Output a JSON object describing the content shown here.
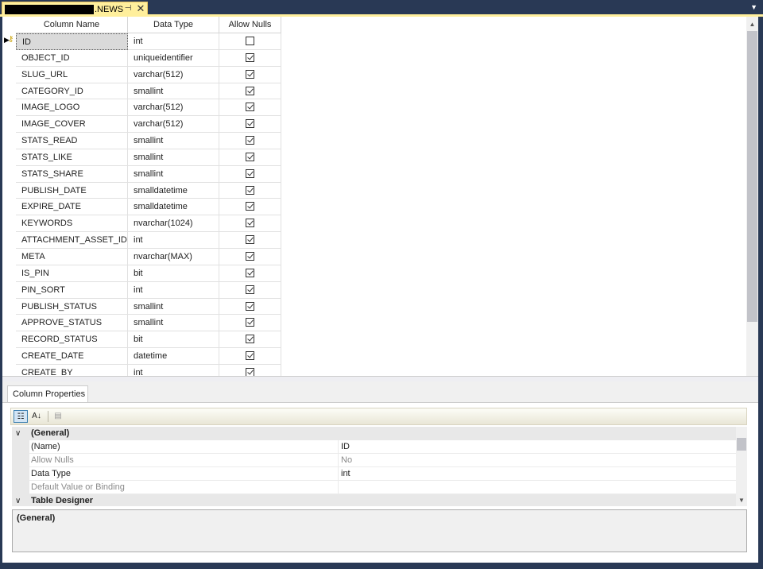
{
  "document_tab": {
    "title": ".NEWS",
    "pin_icon": "pin-icon",
    "close_icon": "close-icon"
  },
  "grid": {
    "headers": {
      "column_name": "Column Name",
      "data_type": "Data Type",
      "allow_nulls": "Allow Nulls"
    },
    "rows": [
      {
        "name": "ID",
        "type": "int",
        "nulls": false
      },
      {
        "name": "OBJECT_ID",
        "type": "uniqueidentifier",
        "nulls": true
      },
      {
        "name": "SLUG_URL",
        "type": "varchar(512)",
        "nulls": true
      },
      {
        "name": "CATEGORY_ID",
        "type": "smallint",
        "nulls": true
      },
      {
        "name": "IMAGE_LOGO",
        "type": "varchar(512)",
        "nulls": true
      },
      {
        "name": "IMAGE_COVER",
        "type": "varchar(512)",
        "nulls": true
      },
      {
        "name": "STATS_READ",
        "type": "smallint",
        "nulls": true
      },
      {
        "name": "STATS_LIKE",
        "type": "smallint",
        "nulls": true
      },
      {
        "name": "STATS_SHARE",
        "type": "smallint",
        "nulls": true
      },
      {
        "name": "PUBLISH_DATE",
        "type": "smalldatetime",
        "nulls": true
      },
      {
        "name": "EXPIRE_DATE",
        "type": "smalldatetime",
        "nulls": true
      },
      {
        "name": "KEYWORDS",
        "type": "nvarchar(1024)",
        "nulls": true
      },
      {
        "name": "ATTACHMENT_ASSET_ID",
        "type": "int",
        "nulls": true
      },
      {
        "name": "META",
        "type": "nvarchar(MAX)",
        "nulls": true
      },
      {
        "name": "IS_PIN",
        "type": "bit",
        "nulls": true
      },
      {
        "name": "PIN_SORT",
        "type": "int",
        "nulls": true
      },
      {
        "name": "PUBLISH_STATUS",
        "type": "smallint",
        "nulls": true
      },
      {
        "name": "APPROVE_STATUS",
        "type": "smallint",
        "nulls": true
      },
      {
        "name": "RECORD_STATUS",
        "type": "bit",
        "nulls": true
      },
      {
        "name": "CREATE_DATE",
        "type": "datetime",
        "nulls": true
      },
      {
        "name": "CREATE_BY",
        "type": "int",
        "nulls": true
      }
    ]
  },
  "properties": {
    "tab_label": "Column Properties",
    "categories": [
      {
        "label": "(General)",
        "items": [
          {
            "name": "(Name)",
            "value": "ID",
            "enabled": true
          },
          {
            "name": "Allow Nulls",
            "value": "No",
            "enabled": false
          },
          {
            "name": "Data Type",
            "value": "int",
            "enabled": true
          },
          {
            "name": "Default Value or Binding",
            "value": "",
            "enabled": false
          }
        ]
      },
      {
        "label": "Table Designer",
        "items": []
      }
    ],
    "description_title": "(General)"
  }
}
